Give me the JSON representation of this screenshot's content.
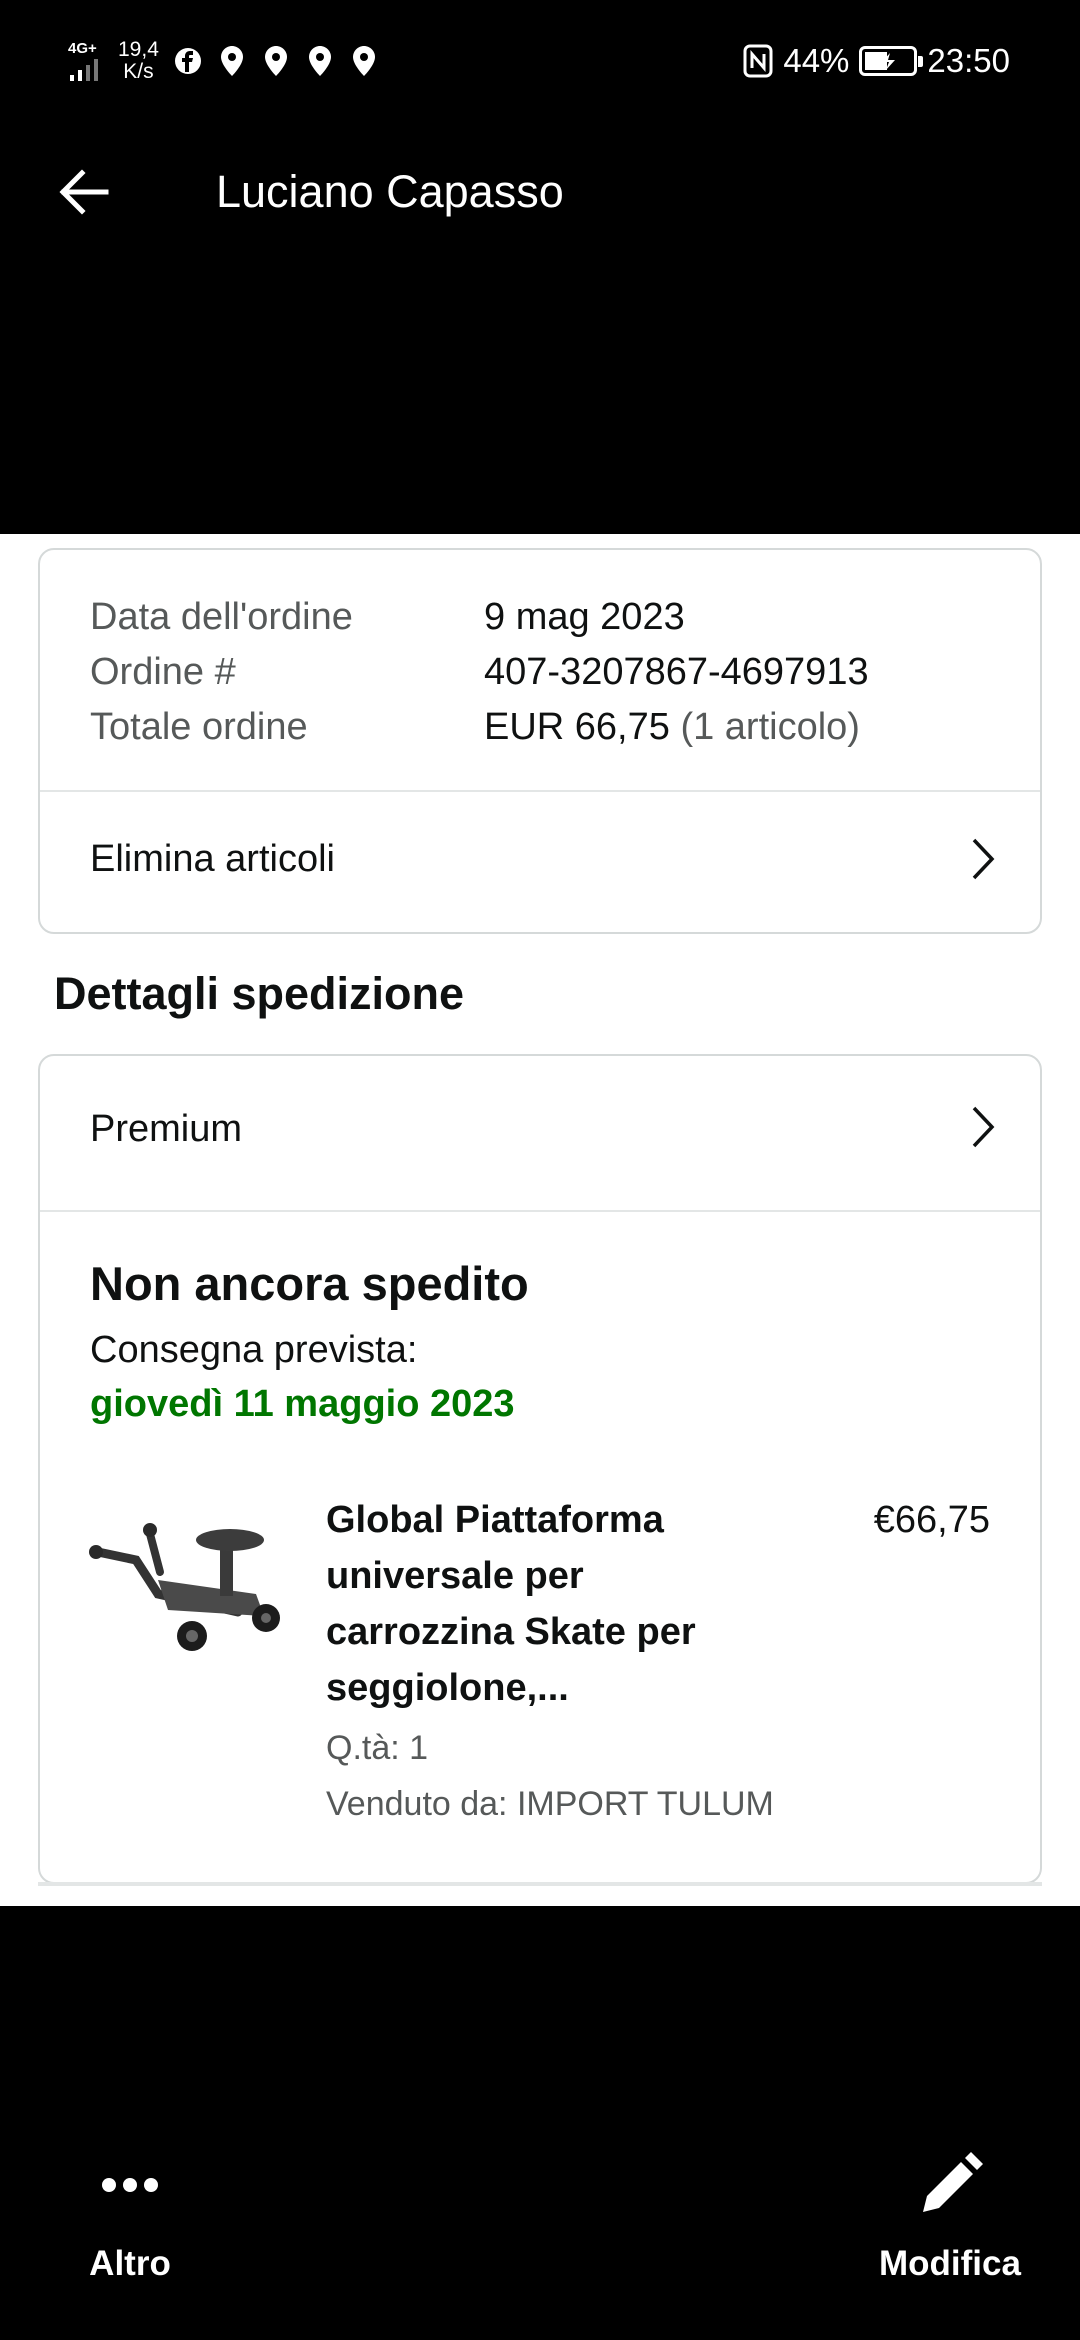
{
  "status_bar": {
    "network": "4G+",
    "speed_value": "19,4",
    "speed_unit": "K/s",
    "battery_percent": "44%",
    "time": "23:50"
  },
  "app_bar": {
    "title": "Luciano Capasso"
  },
  "order_summary": {
    "rows": [
      {
        "label": "Data dell'ordine",
        "value": "9 mag 2023"
      },
      {
        "label": "Ordine #",
        "value": "407-3207867-4697913"
      },
      {
        "label": "Totale ordine",
        "value": "EUR 66,75",
        "suffix": "(1 articolo)"
      }
    ],
    "delete_items_label": "Elimina articoli"
  },
  "shipping": {
    "section_title": "Dettagli spedizione",
    "method": "Premium",
    "status": "Non ancora spedito",
    "delivery_label": "Consegna prevista:",
    "delivery_date": "giovedì 11 maggio 2023",
    "delivery_color": "#007600",
    "item": {
      "name": "Global Piattaforma universale per carrozzina Skate per seggiolone,...",
      "price": "€66,75",
      "quantity": "Q.tà: 1",
      "seller": "Venduto da: IMPORT TULUM"
    }
  },
  "toolbar": {
    "more_label": "Altro",
    "edit_label": "Modifica"
  },
  "icons": {
    "back": "arrow-left-icon",
    "chevron": "chevron-right-icon",
    "more": "more-horizontal-icon",
    "edit": "pencil-icon"
  }
}
